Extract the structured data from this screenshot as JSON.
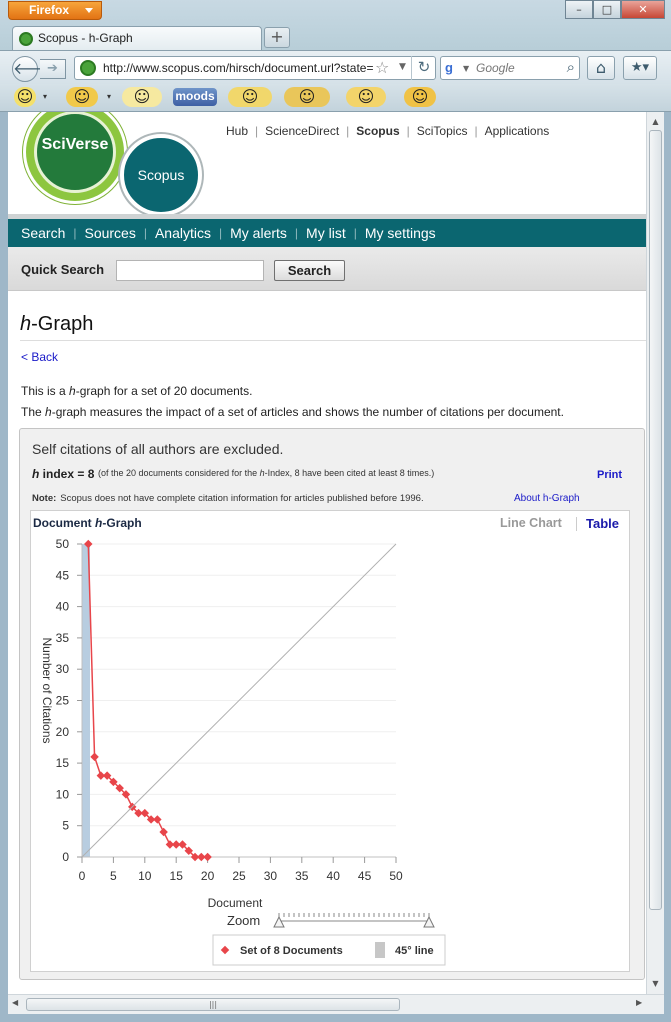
{
  "browser": {
    "app_button": "Firefox",
    "tab_title": "Scopus - h-Graph",
    "url": "http://www.scopus.com/hirsch/document.url?state=",
    "search_placeholder": "Google",
    "addons": {
      "moods_label": "moods"
    }
  },
  "header": {
    "sciverse_logo": "SciVerse",
    "scopus_logo": "Scopus",
    "top_links": [
      "Hub",
      "ScienceDirect",
      "Scopus",
      "SciTopics",
      "Applications"
    ],
    "active_top_link": "Scopus"
  },
  "nav": {
    "items": [
      "Search",
      "Sources",
      "Analytics",
      "My alerts",
      "My list",
      "My settings"
    ]
  },
  "quick_search": {
    "label": "Quick Search",
    "value": "",
    "button": "Search"
  },
  "page": {
    "title_italic": "h",
    "title_rest": "-Graph",
    "back_link": "< Back",
    "desc1_pre": "This is a ",
    "desc1_italic": "h",
    "desc1_post": "-graph for a set of 20 documents.",
    "desc2_pre": "The ",
    "desc2_italic": "h",
    "desc2_post": "-graph measures the impact of a set of articles and shows the number of citations per document."
  },
  "panel": {
    "self_citations": "Self citations of all authors are excluded.",
    "hindex_label_italic": "h",
    "hindex_label_rest": " index = 8",
    "hindex_note_pre": "(of the 20 documents considered for the ",
    "hindex_note_italic": "h",
    "hindex_note_post": "-Index, 8 have been cited at least 8 times.)",
    "print": "Print",
    "note_label": "Note:",
    "note_text": "Scopus does not have complete citation information for articles published before 1996.",
    "about_link": "About h-Graph"
  },
  "chart_tabs": {
    "title_pre": "Document ",
    "title_italic": "h",
    "title_post": "-Graph",
    "line_chart": "Line Chart",
    "table": "Table",
    "zoom_label": "Zoom"
  },
  "chart_data": {
    "type": "line",
    "xlabel": "Document",
    "ylabel": "Number of Citations",
    "xlim": [
      0,
      50
    ],
    "ylim": [
      0,
      50
    ],
    "xticks": [
      0,
      5,
      10,
      15,
      20,
      25,
      30,
      35,
      40,
      45,
      50
    ],
    "yticks": [
      0,
      5,
      10,
      15,
      20,
      25,
      30,
      35,
      40,
      45,
      50
    ],
    "grid": true,
    "legend_position": "bottom",
    "series": [
      {
        "name": "Set of 8 Documents",
        "type": "line",
        "color": "#e8454a",
        "x": [
          1,
          2,
          3,
          4,
          5,
          6,
          7,
          8,
          9,
          10,
          11,
          12,
          13,
          14,
          15,
          16,
          17,
          18,
          19,
          20
        ],
        "y": [
          50,
          16,
          13,
          13,
          12,
          11,
          10,
          8,
          7,
          7,
          6,
          6,
          4,
          2,
          2,
          2,
          1,
          0,
          0,
          0
        ]
      },
      {
        "name": "45° line",
        "type": "diagonal",
        "color": "#b0b0b0",
        "x": [
          0,
          50
        ],
        "y": [
          0,
          50
        ]
      }
    ],
    "h_index_bar": {
      "x": 0,
      "y": 50,
      "color": "#b8cde0"
    }
  },
  "colors": {
    "teal": "#0b6670",
    "link": "#1a1ac8",
    "series_red": "#e8454a"
  }
}
